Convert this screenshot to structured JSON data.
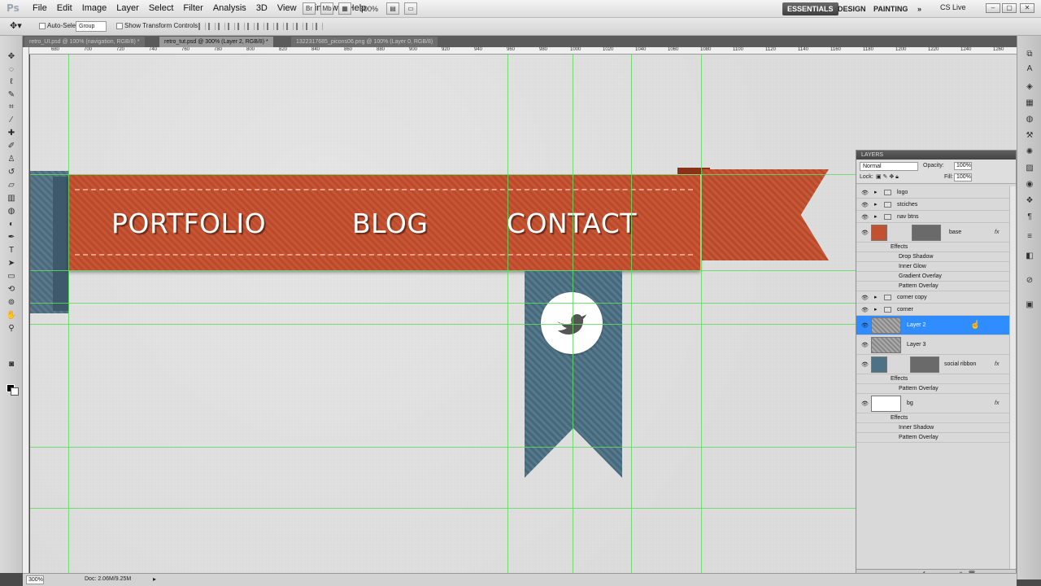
{
  "app": {
    "logo": "Ps"
  },
  "menu": [
    "File",
    "Edit",
    "Image",
    "Layer",
    "Select",
    "Filter",
    "Analysis",
    "3D",
    "View",
    "Window",
    "Help"
  ],
  "toolbar": {
    "zoom": "300%"
  },
  "workspaces": {
    "essentials": "ESSENTIALS",
    "design": "DESIGN",
    "painting": "PAINTING",
    "more": "»",
    "cslive": "CS Live"
  },
  "window_controls": {
    "min": "–",
    "max": "▢",
    "close": "✕"
  },
  "options": {
    "auto_select": "Auto-Select:",
    "group": "Group",
    "show_transform": "Show Transform Controls"
  },
  "tabs": [
    {
      "label": "retro_UI.psd @ 100% (navigation, RGB/8) *"
    },
    {
      "label": "retro_tut.psd @ 300% (Layer 2, RGB/8) *"
    },
    {
      "label": "1322317685_picons06.png @ 100% (Layer 0, RGB/8)"
    }
  ],
  "ruler": [
    "680",
    "700",
    "720",
    "740",
    "760",
    "780",
    "800",
    "820",
    "840",
    "860",
    "880",
    "900",
    "920",
    "940",
    "960",
    "980",
    "1000",
    "1020",
    "1040",
    "1060",
    "1080",
    "1100",
    "1120",
    "1140",
    "1160",
    "1180",
    "1200",
    "1220",
    "1240",
    "1260"
  ],
  "canvas": {
    "nav_items": [
      "PORTFOLIO",
      "BLOG",
      "CONTACT"
    ],
    "colors": {
      "ribbon": "#c2522f",
      "social": "#4e7285",
      "guide": "#5fdc5f",
      "bg": "#dcdcdc"
    }
  },
  "layers_panel": {
    "title": "LAYERS",
    "blend_mode": "Normal",
    "opacity_label": "Opacity:",
    "opacity": "100%",
    "lock_label": "Lock:",
    "fill_label": "Fill:",
    "fill": "100%",
    "rows": [
      {
        "name": "logo",
        "kind": "group"
      },
      {
        "name": "stciches",
        "kind": "group"
      },
      {
        "name": "nav btns",
        "kind": "group"
      },
      {
        "name": "base",
        "kind": "layer",
        "fx": "fx"
      },
      {
        "name": "Effects",
        "kind": "effects"
      },
      {
        "name": "Drop Shadow",
        "kind": "effect"
      },
      {
        "name": "Inner Glow",
        "kind": "effect"
      },
      {
        "name": "Gradient Overlay",
        "kind": "effect"
      },
      {
        "name": "Pattern Overlay",
        "kind": "effect"
      },
      {
        "name": "corner copy",
        "kind": "group"
      },
      {
        "name": "corner",
        "kind": "group"
      },
      {
        "name": "Layer 2",
        "kind": "layer",
        "selected": true
      },
      {
        "name": "Layer 3",
        "kind": "layer"
      },
      {
        "name": "social ribbon",
        "kind": "layer",
        "fx": "fx"
      },
      {
        "name": "Effects",
        "kind": "effects"
      },
      {
        "name": "Pattern Overlay",
        "kind": "effect"
      },
      {
        "name": "bg",
        "kind": "layer",
        "fx": "fx"
      },
      {
        "name": "Effects",
        "kind": "effects"
      },
      {
        "name": "Inner Shadow",
        "kind": "effect"
      },
      {
        "name": "Pattern Overlay",
        "kind": "effect"
      }
    ]
  },
  "status": {
    "zoom": "300%",
    "doc": "Doc: 2.06M/9.25M"
  }
}
